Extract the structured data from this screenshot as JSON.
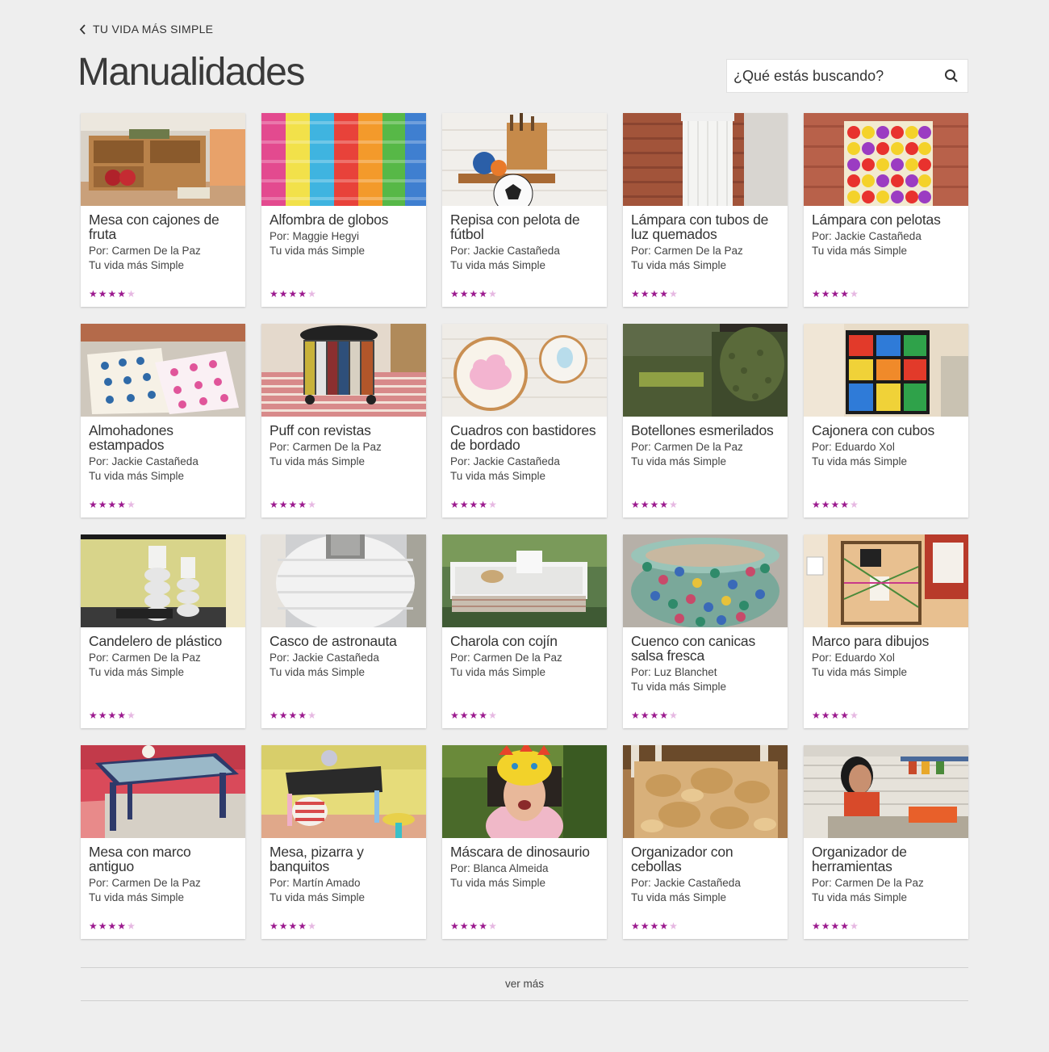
{
  "header": {
    "back_label": "TU VIDA MÁS SIMPLE",
    "title": "Manualidades"
  },
  "search": {
    "placeholder": "¿Qué estás buscando?"
  },
  "cards": [
    {
      "title": "Mesa con cajones de fruta",
      "author": "Por: Carmen De la Paz",
      "source": "Tu vida más Simple",
      "rating": 4
    },
    {
      "title": "Alfombra de globos",
      "author": "Por: Maggie Hegyi",
      "source": "Tu vida más Simple",
      "rating": 4
    },
    {
      "title": "Repisa con pelota de fútbol",
      "author": "Por: Jackie Castañeda",
      "source": "Tu vida más Simple",
      "rating": 4
    },
    {
      "title": "Lámpara con tubos de luz quemados",
      "author": "Por: Carmen De la Paz",
      "source": "Tu vida más Simple",
      "rating": 4
    },
    {
      "title": "Lámpara con pelotas",
      "author": "Por: Jackie Castañeda",
      "source": "Tu vida más Simple",
      "rating": 4
    },
    {
      "title": "Almohadones estampados",
      "author": "Por: Jackie Castañeda",
      "source": "Tu vida más Simple",
      "rating": 4
    },
    {
      "title": "Puff con revistas",
      "author": "Por: Carmen De la Paz",
      "source": "Tu vida más Simple",
      "rating": 4
    },
    {
      "title": "Cuadros con bastidores de bordado",
      "author": "Por: Jackie Castañeda",
      "source": "Tu vida más Simple",
      "rating": 4
    },
    {
      "title": "Botellones esmerilados",
      "author": "Por: Carmen De la Paz",
      "source": "Tu vida más Simple",
      "rating": 4
    },
    {
      "title": "Cajonera con cubos",
      "author": "Por: Eduardo Xol",
      "source": "Tu vida más Simple",
      "rating": 4
    },
    {
      "title": "Candelero de plástico",
      "author": "Por: Carmen De la Paz",
      "source": "Tu vida más Simple",
      "rating": 4
    },
    {
      "title": "Casco de astronauta",
      "author": "Por:  Jackie Castañeda",
      "source": "Tu vida más Simple",
      "rating": 4
    },
    {
      "title": "Charola con cojín",
      "author": "Por: Carmen De la Paz",
      "source": "Tu vida más Simple",
      "rating": 4
    },
    {
      "title": "Cuenco con canicas salsa fresca",
      "author": "Por: Luz Blanchet",
      "source": "Tu vida más Simple",
      "rating": 4
    },
    {
      "title": "Marco para dibujos",
      "author": "Por: Eduardo Xol",
      "source": "Tu vida más Simple",
      "rating": 4
    },
    {
      "title": "Mesa con marco antiguo",
      "author": "Por: Carmen De la Paz",
      "source": "Tu vida más Simple",
      "rating": 4
    },
    {
      "title": "Mesa, pizarra y banquitos",
      "author": "Por:  Martín Amado",
      "source": "Tu vida más Simple",
      "rating": 4
    },
    {
      "title": "Máscara de dinosaurio",
      "author": "Por: Blanca Almeida",
      "source": "Tu vida más Simple",
      "rating": 4
    },
    {
      "title": "Organizador con cebollas",
      "author": "Por: Jackie Castañeda",
      "source": "Tu vida más Simple",
      "rating": 4
    },
    {
      "title": "Organizador de herramientas",
      "author": "Por: Carmen De la Paz",
      "source": "Tu vida más Simple",
      "rating": 4
    }
  ],
  "more_label": "ver más",
  "colors": {
    "background": "#eeeeee",
    "star_on": "#9c1a8f",
    "star_off": "#e6b8e2"
  }
}
